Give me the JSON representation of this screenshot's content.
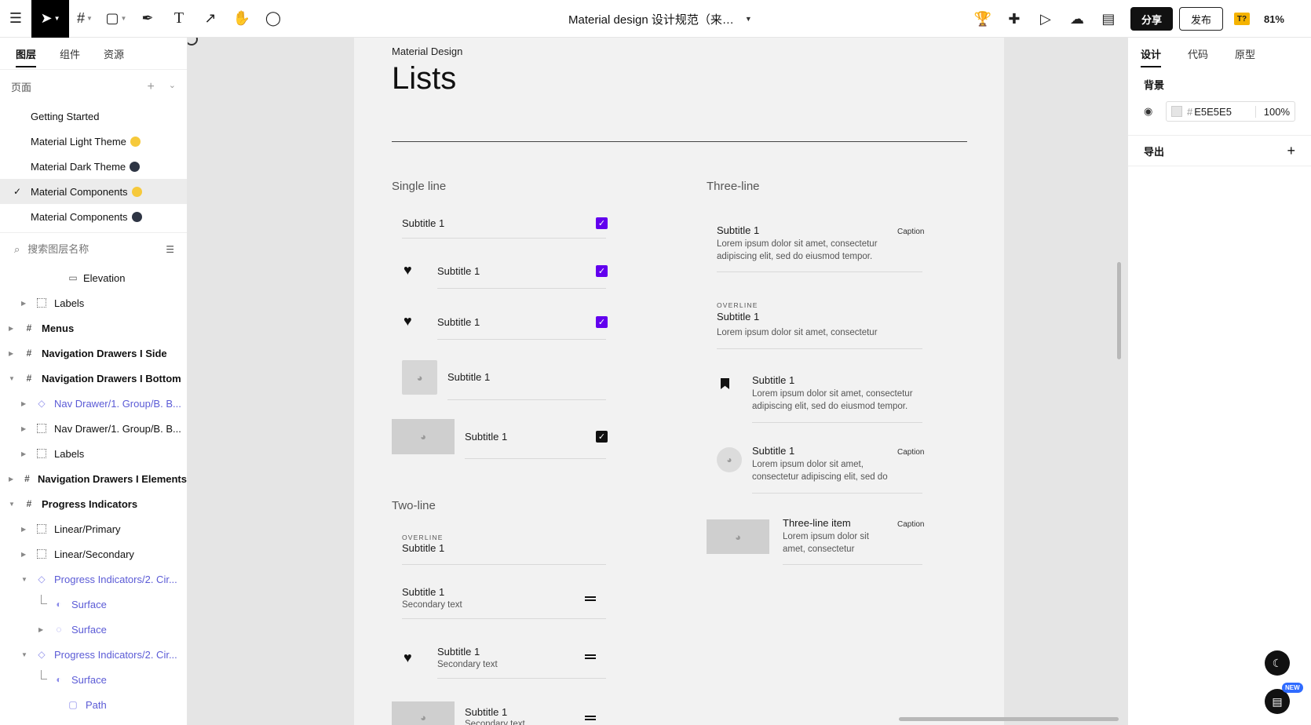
{
  "toolbar": {
    "title": "Material design 设计规范（来…",
    "share": "分享",
    "publish": "发布",
    "t_badge": "T?",
    "zoom": "81%"
  },
  "left_panel": {
    "tabs": [
      "图层",
      "组件",
      "资源"
    ],
    "pages_label": "页面",
    "pages": [
      {
        "name": "Getting Started",
        "dot": ""
      },
      {
        "name": "Material Light Theme",
        "dot": "light"
      },
      {
        "name": "Material Dark Theme",
        "dot": "dark"
      },
      {
        "name": "Material Components",
        "dot": "light",
        "selected": true
      },
      {
        "name": "Material Components",
        "dot": "dark"
      }
    ],
    "search_placeholder": "搜索图层名称",
    "layers": [
      {
        "name": "Elevation",
        "indent": 68,
        "icon": "slot",
        "arrow": "",
        "style": ""
      },
      {
        "name": "Labels",
        "indent": 28,
        "icon": "grid",
        "arrow": "right",
        "style": ""
      },
      {
        "name": "Menus",
        "indent": 12,
        "icon": "frame",
        "arrow": "right",
        "style": "bold"
      },
      {
        "name": "Navigation Drawers I Side",
        "indent": 12,
        "icon": "frame",
        "arrow": "right",
        "style": "bold"
      },
      {
        "name": "Navigation Drawers I Bottom",
        "indent": 12,
        "icon": "frame",
        "arrow": "down",
        "style": "bold"
      },
      {
        "name": "Nav Drawer/1. Group/B. B...",
        "indent": 28,
        "icon": "component",
        "arrow": "right",
        "style": "comp"
      },
      {
        "name": "Nav Drawer/1. Group/B. B...",
        "indent": 28,
        "icon": "grid",
        "arrow": "right",
        "style": ""
      },
      {
        "name": "Labels",
        "indent": 28,
        "icon": "grid",
        "arrow": "right",
        "style": ""
      },
      {
        "name": "Navigation Drawers I Elements",
        "indent": 12,
        "icon": "frame",
        "arrow": "right",
        "style": "bold"
      },
      {
        "name": "Progress Indicators",
        "indent": 12,
        "icon": "frame",
        "arrow": "down",
        "style": "bold"
      },
      {
        "name": "Linear/Primary",
        "indent": 28,
        "icon": "grid",
        "arrow": "right",
        "style": ""
      },
      {
        "name": "Linear/Secondary",
        "indent": 28,
        "icon": "grid",
        "arrow": "right",
        "style": ""
      },
      {
        "name": "Progress Indicators/2. Cir...",
        "indent": 28,
        "icon": "component",
        "arrow": "down",
        "style": "comp"
      },
      {
        "name": "Surface",
        "indent": 50,
        "icon": "half",
        "arrow": "",
        "style": "comp",
        "conn": true
      },
      {
        "name": "Surface",
        "indent": 50,
        "icon": "spin",
        "arrow": "right",
        "style": "comp"
      },
      {
        "name": "Progress Indicators/2. Cir...",
        "indent": 28,
        "icon": "component",
        "arrow": "down",
        "style": "comp"
      },
      {
        "name": "Surface",
        "indent": 50,
        "icon": "half",
        "arrow": "",
        "style": "comp",
        "conn": true
      },
      {
        "name": "Path",
        "indent": 68,
        "icon": "square",
        "arrow": "",
        "style": "comp"
      }
    ]
  },
  "canvas": {
    "subtitle": "Material Design",
    "title": "Lists",
    "single_line": {
      "heading": "Single line",
      "items": [
        "Subtitle 1",
        "Subtitle 1",
        "Subtitle 1",
        "Subtitle 1",
        "Subtitle 1"
      ]
    },
    "two_line": {
      "heading": "Two-line",
      "overline": "OVERLINE",
      "items": [
        "Subtitle 1",
        "Subtitle 1",
        "Subtitle 1",
        "Subtitle 1"
      ],
      "secondary": "Secondary text"
    },
    "three_line": {
      "heading": "Three-line",
      "caption": "Caption",
      "overline": "OVERLINE",
      "item1_title": "Subtitle 1",
      "item1_body": "Lorem ipsum dolor sit amet, consectetur adipiscing elit, sed do eiusmod tempor.",
      "item2_title": "Subtitle 1",
      "item2_body": "Lorem ipsum dolor sit amet, consectetur",
      "item3_title": "Subtitle 1",
      "item3_body": "Lorem ipsum dolor sit amet, consectetur adipiscing elit, sed do eiusmod tempor.",
      "item4_title": "Subtitle 1",
      "item4_body": "Lorem ipsum dolor sit amet, consectetur adipiscing elit, sed do",
      "item5_title": "Three-line item",
      "item5_body": "Lorem ipsum dolor sit amet, consectetur"
    },
    "accent_color": "#6200EE"
  },
  "right_panel": {
    "tabs": [
      "设计",
      "代码",
      "原型"
    ],
    "background_label": "背景",
    "color_hash": "#",
    "color_value": "E5E5E5",
    "opacity": "100%",
    "export_label": "导出"
  },
  "fab_badge": "NEW"
}
